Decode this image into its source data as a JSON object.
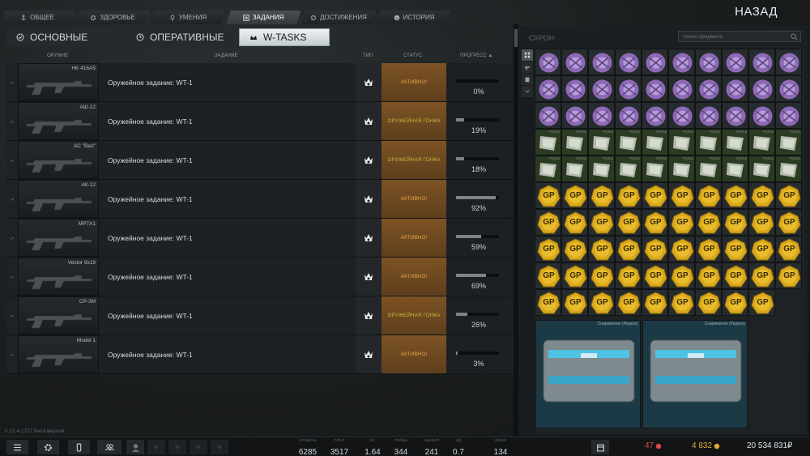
{
  "nav": {
    "tabs": [
      {
        "label": "Общее",
        "icon": "anchor-icon"
      },
      {
        "label": "Здоровье",
        "icon": "gear-icon"
      },
      {
        "label": "Умения",
        "icon": "bulb-icon"
      },
      {
        "label": "Задания",
        "icon": "task-list-icon"
      },
      {
        "label": "Достижения",
        "icon": "gear-icon"
      },
      {
        "label": "История",
        "icon": "info-icon"
      }
    ],
    "active": 3
  },
  "back_label": "НАЗАД",
  "subtabs": [
    {
      "label": "ОСНОВНЫЕ"
    },
    {
      "label": "ОПЕРАТИВНЫЕ"
    },
    {
      "label": "W-TASKS"
    }
  ],
  "table": {
    "headers": {
      "weapon": "ОРУЖИЕ",
      "task": "ЗАДАНИЕ",
      "type": "ТИП",
      "status": "СТАТУС",
      "progress": "ПРОГРЕСС ▲"
    },
    "rows": [
      {
        "weapon": "HK 416A5",
        "task": "Оружейное задание: WT-1",
        "status": "АКТИВНО!",
        "status_kind": "active",
        "progress": 0,
        "progress_text": "0%"
      },
      {
        "weapon": "АШ-12",
        "task": "Оружейное задание: WT-1",
        "status": "ОРУЖЕЙНАЯ ГОНКА",
        "status_kind": "race",
        "progress": 19,
        "progress_text": "19%"
      },
      {
        "weapon": "АС \"Вал\"",
        "task": "Оружейное задание: WT-1",
        "status": "ОРУЖЕЙНАЯ ГОНКА",
        "status_kind": "race",
        "progress": 18,
        "progress_text": "18%"
      },
      {
        "weapon": "АК-12",
        "task": "Оружейное задание: WT-1",
        "status": "АКТИВНО!",
        "status_kind": "active",
        "progress": 92,
        "progress_text": "92%"
      },
      {
        "weapon": "MP7A1",
        "task": "Оружейное задание: WT-1",
        "status": "АКТИВНО!",
        "status_kind": "active",
        "progress": 59,
        "progress_text": "59%"
      },
      {
        "weapon": "Vector 9x19",
        "task": "Оружейное задание: WT-1",
        "status": "АКТИВНО!",
        "status_kind": "active",
        "progress": 69,
        "progress_text": "69%"
      },
      {
        "weapon": "СР-3М",
        "task": "Оружейное задание: WT-1",
        "status": "ОРУЖЕЙНАЯ ГОНКА",
        "status_kind": "race",
        "progress": 26,
        "progress_text": "26%"
      },
      {
        "weapon": "Model 1",
        "task": "Оружейное задание: WT-1",
        "status": "АКТИВНО!",
        "status_kind": "active",
        "progress": 3,
        "progress_text": "3%"
      }
    ]
  },
  "inventory": {
    "title": "СХРОН",
    "search_placeholder": "поиск предмета",
    "item_rubles_label": "Рубли",
    "item_gp_label": "GP",
    "item_case_label": "Снаряжение (Редкое)"
  },
  "version": "0.12.4.1727 Бета версия",
  "bottom": {
    "stats": [
      {
        "label": "уровень",
        "value": "6285"
      },
      {
        "label": "опыт",
        "value": "3517"
      },
      {
        "label": "к/с",
        "value": "1.64"
      },
      {
        "label": "рейды",
        "value": "344"
      },
      {
        "label": "выжил",
        "value": "241"
      },
      {
        "label": "к/д",
        "value": "0.7"
      },
      {
        "label": "вещи",
        "value": "134"
      }
    ],
    "currency": {
      "gp": "47",
      "eur": "4 832",
      "rub": "20 534 831₽"
    }
  },
  "colors": {
    "active_status": "#e9a347",
    "race_status": "#c6b83e",
    "rubles_accent": "#a6d04e",
    "gp_gold": "#d9a71a",
    "crystal_purple": "#8c6ab5"
  }
}
